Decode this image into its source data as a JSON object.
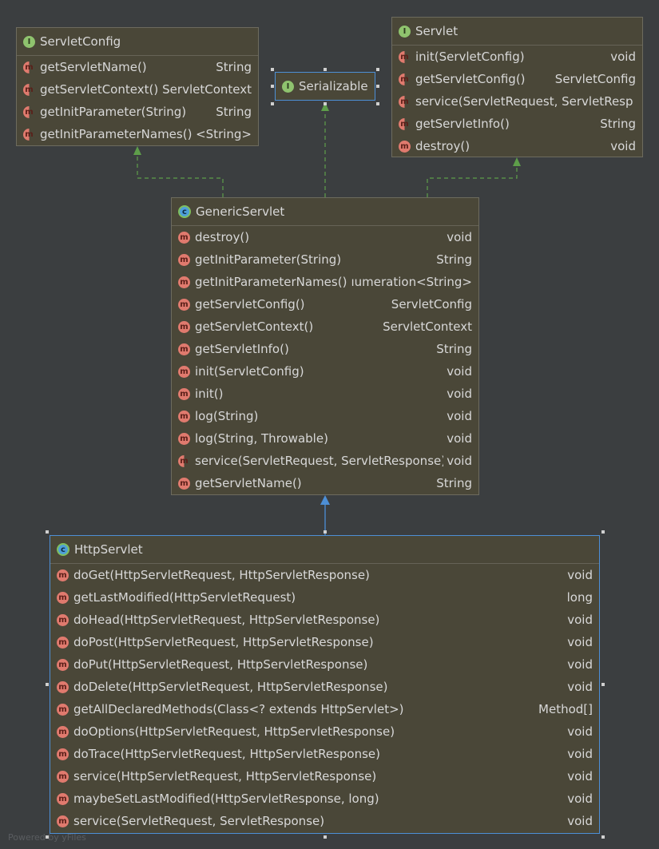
{
  "nodes": {
    "servlet_config": {
      "kind": "I",
      "name": "ServletConfig",
      "methods": [
        {
          "sig": "getServletName()",
          "ret": "String"
        },
        {
          "sig": "getServletContext()",
          "ret": "ServletContext"
        },
        {
          "sig": "getInitParameter(String)",
          "ret": "String"
        },
        {
          "sig": "getInitParameterNames()",
          "ret": "<String>"
        }
      ]
    },
    "serializable": {
      "kind": "I",
      "name": "Serializable"
    },
    "servlet": {
      "kind": "I",
      "name": "Servlet",
      "methods": [
        {
          "sig": "init(ServletConfig)",
          "ret": "void"
        },
        {
          "sig": "getServletConfig()",
          "ret": "ServletConfig"
        },
        {
          "sig": "service(ServletRequest, ServletRespon",
          "ret": ""
        },
        {
          "sig": "getServletInfo()",
          "ret": "String"
        },
        {
          "sig": "destroy()",
          "ret": "void"
        }
      ]
    },
    "generic_servlet": {
      "kind": "C",
      "name": "GenericServlet",
      "methods": [
        {
          "sig": "destroy()",
          "ret": "void"
        },
        {
          "sig": "getInitParameter(String)",
          "ret": "String"
        },
        {
          "sig": "getInitParameterNames()",
          "ret": "ıumeration<String>"
        },
        {
          "sig": "getServletConfig()",
          "ret": "ServletConfig"
        },
        {
          "sig": "getServletContext()",
          "ret": "ServletContext"
        },
        {
          "sig": "getServletInfo()",
          "ret": "String"
        },
        {
          "sig": "init(ServletConfig)",
          "ret": "void"
        },
        {
          "sig": "init()",
          "ret": "void"
        },
        {
          "sig": "log(String)",
          "ret": "void"
        },
        {
          "sig": "log(String, Throwable)",
          "ret": "void"
        },
        {
          "sig": "service(ServletRequest, ServletResponse)",
          "ret": "void"
        },
        {
          "sig": "getServletName()",
          "ret": "String"
        }
      ]
    },
    "http_servlet": {
      "kind": "C",
      "name": "HttpServlet",
      "methods": [
        {
          "sig": "doGet(HttpServletRequest, HttpServletResponse)",
          "ret": "void"
        },
        {
          "sig": "getLastModified(HttpServletRequest)",
          "ret": "long"
        },
        {
          "sig": "doHead(HttpServletRequest, HttpServletResponse)",
          "ret": "void"
        },
        {
          "sig": "doPost(HttpServletRequest, HttpServletResponse)",
          "ret": "void"
        },
        {
          "sig": "doPut(HttpServletRequest, HttpServletResponse)",
          "ret": "void"
        },
        {
          "sig": "doDelete(HttpServletRequest, HttpServletResponse)",
          "ret": "void"
        },
        {
          "sig": "getAllDeclaredMethods(Class<? extends HttpServlet>)",
          "ret": "Method[]"
        },
        {
          "sig": "doOptions(HttpServletRequest, HttpServletResponse)",
          "ret": "void"
        },
        {
          "sig": "doTrace(HttpServletRequest, HttpServletResponse)",
          "ret": "void"
        },
        {
          "sig": "service(HttpServletRequest, HttpServletResponse)",
          "ret": "void"
        },
        {
          "sig": "maybeSetLastModified(HttpServletResponse, long)",
          "ret": "void"
        },
        {
          "sig": "service(ServletRequest, ServletResponse)",
          "ret": "void"
        }
      ]
    }
  },
  "edges": [
    {
      "from": "generic_servlet",
      "to": "servlet_config",
      "type": "implements"
    },
    {
      "from": "generic_servlet",
      "to": "serializable",
      "type": "implements"
    },
    {
      "from": "generic_servlet",
      "to": "servlet",
      "type": "implements"
    },
    {
      "from": "http_servlet",
      "to": "generic_servlet",
      "type": "extends"
    }
  ],
  "colors": {
    "background": "#3b3e40",
    "box": "#4a4738",
    "implements_edge": "#5e9e4a",
    "extends_edge": "#4d8fd6",
    "selection": "#4d8fd6"
  },
  "watermark": "Powered by yFiles"
}
